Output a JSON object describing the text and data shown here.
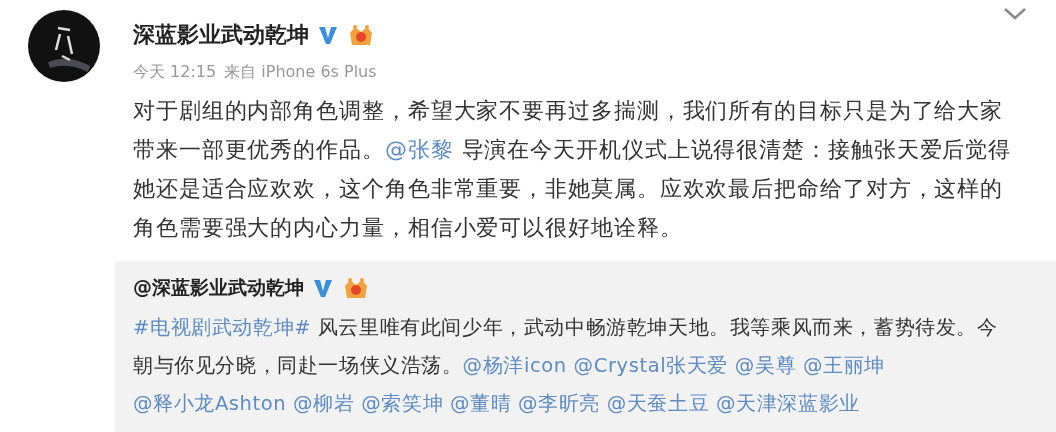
{
  "post": {
    "author": "深蓝影业武动乾坤",
    "verified": true,
    "time": "今天 12:15",
    "source": "来自 iPhone 6s Plus",
    "body": [
      {
        "kind": "text",
        "text": "对于剧组的内部角色调整，希望大家不要再过多揣测，我们所有的目标只是为了给大家带来一部更优秀的作品。"
      },
      {
        "kind": "mention",
        "text": "@张黎"
      },
      {
        "kind": "text",
        "text": " 导演在今天开机仪式上说得很清楚：接触张天爱后觉得她还是适合应欢欢，这个角色非常重要，非她莫属。应欢欢最后把命给了对方，这样的角色需要强大的内心力量，相信小爱可以很好地诠释。"
      }
    ]
  },
  "repost": {
    "author": "@深蓝影业武动乾坤",
    "verified": true,
    "body": [
      {
        "kind": "mention",
        "text": "#电视剧武动乾坤#"
      },
      {
        "kind": "text",
        "text": " 风云里唯有此间少年，武动中畅游乾坤天地。我等乘风而来，蓄势待发。今朝与你见分晓，同赴一场侠义浩荡。"
      },
      {
        "kind": "mention",
        "text": "@杨洋icon"
      },
      {
        "kind": "mention",
        "text": "@Crystal张天爱"
      },
      {
        "kind": "mention",
        "text": "@吴尊"
      },
      {
        "kind": "mention",
        "text": "@王丽坤"
      },
      {
        "kind": "mention",
        "text": "@释小龙Ashton"
      },
      {
        "kind": "mention",
        "text": "@柳岩"
      },
      {
        "kind": "mention",
        "text": "@索笑坤"
      },
      {
        "kind": "mention",
        "text": "@董晴"
      },
      {
        "kind": "mention",
        "text": "@李昕亮"
      },
      {
        "kind": "mention",
        "text": "@天蚕土豆"
      },
      {
        "kind": "mention",
        "text": "@天津深蓝影业"
      }
    ]
  }
}
